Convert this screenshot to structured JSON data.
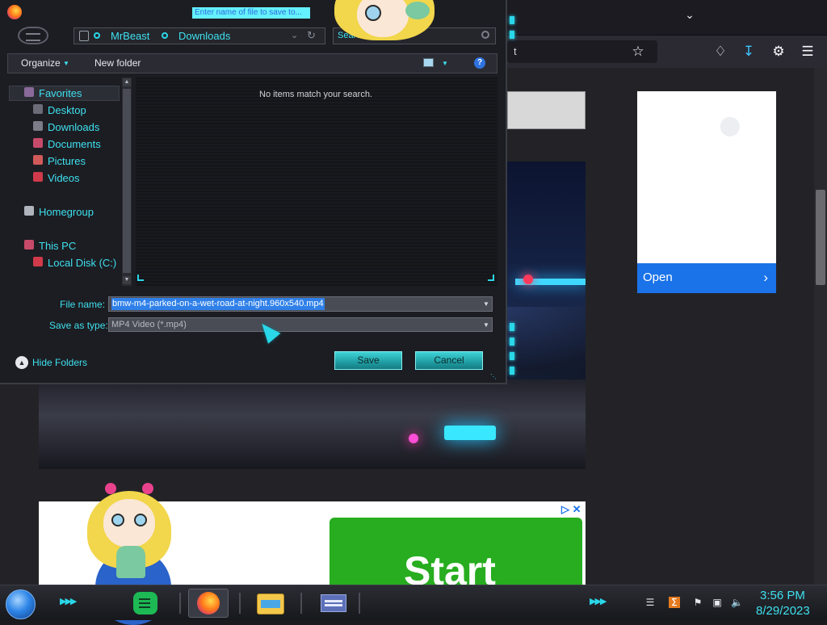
{
  "dialog": {
    "title_hint": "Enter name of file to save to...",
    "breadcrumb": [
      "MrBeast",
      "Downloads"
    ],
    "search_placeholder": "Search",
    "toolbar": {
      "organize_label": "Organize",
      "new_folder_label": "New folder"
    },
    "nav": {
      "favorites_label": "Favorites",
      "favorites": [
        "Desktop",
        "Downloads",
        "Documents",
        "Pictures",
        "Videos"
      ],
      "homegroup_label": "Homegroup",
      "this_pc_label": "This PC",
      "drives": [
        "Local Disk (C:)"
      ]
    },
    "empty_message": "No items match your search.",
    "file_name_label": "File name:",
    "file_name_value": "bmw-m4-parked-on-a-wet-road-at-night.960x540.mp4",
    "save_type_label": "Save as type:",
    "save_type_value": "MP4 Video (*.mp4)",
    "hide_folders_label": "Hide Folders",
    "save_label": "Save",
    "cancel_label": "Cancel"
  },
  "browser": {
    "url_fragment": "t",
    "ad_open_label": "Open",
    "ad_start_label": "Start"
  },
  "taskbar": {
    "clock_time": "3:56 PM",
    "clock_date": "8/29/2023"
  },
  "colors": {
    "accent_cyan": "#3ee0ef",
    "selection_blue": "#2f80e8",
    "ad_green": "#27ad1f",
    "ad_blue": "#1a73e8"
  },
  "icons": [
    "firefox-icon",
    "search-icon",
    "help-icon",
    "bookmark-star-icon",
    "pocket-icon",
    "download-icon",
    "extensions-icon",
    "menu-icon",
    "start-orb-icon",
    "notes-icon",
    "explorer-icon",
    "volume-icon",
    "network-icon",
    "flag-icon"
  ]
}
